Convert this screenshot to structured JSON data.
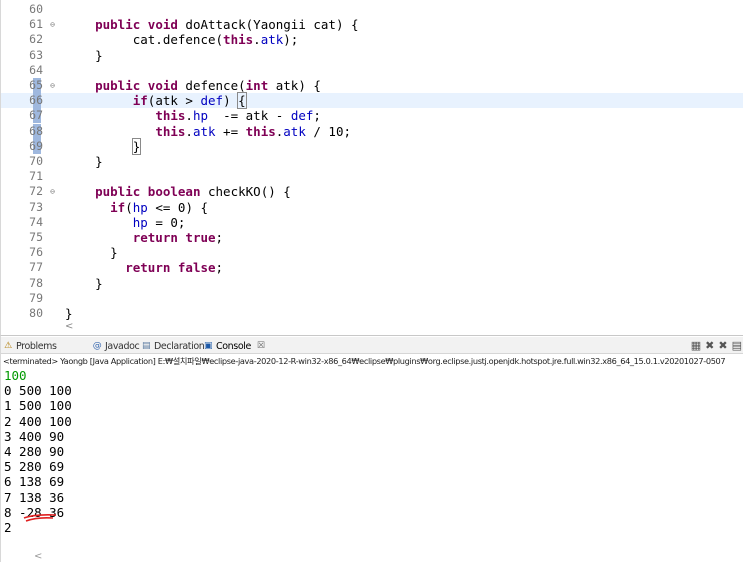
{
  "editor": {
    "lines": [
      {
        "num": "60",
        "fold": "",
        "segs": []
      },
      {
        "num": "61",
        "fold": "⊖",
        "segs": [
          [
            "",
            "    "
          ],
          [
            "kw",
            "public"
          ],
          [
            "",
            " "
          ],
          [
            "kw",
            "void"
          ],
          [
            "",
            " doAttack(Yaongii cat) {"
          ]
        ]
      },
      {
        "num": "62",
        "fold": "",
        "segs": [
          [
            "",
            "         cat.defence("
          ],
          [
            "kw",
            "this"
          ],
          [
            "",
            "."
          ],
          [
            "fld",
            "atk"
          ],
          [
            "",
            ");"
          ]
        ]
      },
      {
        "num": "63",
        "fold": "",
        "segs": [
          [
            "",
            "    }"
          ]
        ]
      },
      {
        "num": "64",
        "fold": "",
        "segs": []
      },
      {
        "num": "65",
        "fold": "⊖",
        "segs": [
          [
            "",
            "    "
          ],
          [
            "kw",
            "public"
          ],
          [
            "",
            " "
          ],
          [
            "kw",
            "void"
          ],
          [
            "",
            " defence("
          ],
          [
            "kw",
            "int"
          ],
          [
            "",
            " atk) {"
          ]
        ]
      },
      {
        "num": "66",
        "fold": "",
        "segs": [
          [
            "",
            "         "
          ],
          [
            "kw",
            "if"
          ],
          [
            "",
            "(atk > "
          ],
          [
            "fld",
            "def"
          ],
          [
            "",
            ") {"
          ]
        ]
      },
      {
        "num": "67",
        "fold": "",
        "segs": [
          [
            "",
            "            "
          ],
          [
            "kw",
            "this"
          ],
          [
            "",
            "."
          ],
          [
            "fld",
            "hp"
          ],
          [
            "",
            "  -= atk - "
          ],
          [
            "fld",
            "def"
          ],
          [
            "",
            ";"
          ]
        ]
      },
      {
        "num": "68",
        "fold": "",
        "segs": [
          [
            "",
            "            "
          ],
          [
            "kw",
            "this"
          ],
          [
            "",
            "."
          ],
          [
            "fld",
            "atk"
          ],
          [
            "",
            " += "
          ],
          [
            "kw",
            "this"
          ],
          [
            "",
            "."
          ],
          [
            "fld",
            "atk"
          ],
          [
            "",
            " / 10;"
          ]
        ]
      },
      {
        "num": "69",
        "fold": "",
        "segs": [
          [
            "",
            "         }"
          ]
        ]
      },
      {
        "num": "70",
        "fold": "",
        "segs": [
          [
            "",
            "    }"
          ]
        ]
      },
      {
        "num": "71",
        "fold": "",
        "segs": []
      },
      {
        "num": "72",
        "fold": "⊖",
        "segs": [
          [
            "",
            "    "
          ],
          [
            "kw",
            "public"
          ],
          [
            "",
            " "
          ],
          [
            "kw",
            "boolean"
          ],
          [
            "",
            " checkKO() {"
          ]
        ]
      },
      {
        "num": "73",
        "fold": "",
        "segs": [
          [
            "",
            "      "
          ],
          [
            "kw",
            "if"
          ],
          [
            "",
            "("
          ],
          [
            "fld",
            "hp"
          ],
          [
            "",
            " <= 0) {"
          ]
        ]
      },
      {
        "num": "74",
        "fold": "",
        "segs": [
          [
            "",
            "         "
          ],
          [
            "fld",
            "hp"
          ],
          [
            "",
            " = 0;"
          ]
        ]
      },
      {
        "num": "75",
        "fold": "",
        "segs": [
          [
            "",
            "         "
          ],
          [
            "kw",
            "return"
          ],
          [
            "",
            " "
          ],
          [
            "kw",
            "true"
          ],
          [
            "",
            ";"
          ]
        ]
      },
      {
        "num": "76",
        "fold": "",
        "segs": [
          [
            "",
            "      }"
          ]
        ]
      },
      {
        "num": "77",
        "fold": "",
        "segs": [
          [
            "",
            "        "
          ],
          [
            "kw",
            "return"
          ],
          [
            "",
            " "
          ],
          [
            "kw",
            "false"
          ],
          [
            "",
            ";"
          ]
        ]
      },
      {
        "num": "78",
        "fold": "",
        "segs": [
          [
            "",
            "    }"
          ]
        ]
      },
      {
        "num": "79",
        "fold": "",
        "segs": []
      },
      {
        "num": "80",
        "fold": "",
        "segs": [
          [
            "",
            "}"
          ]
        ]
      }
    ],
    "current_line": "66",
    "highlight_bar_lines": [
      "65",
      "66",
      "67",
      "68",
      "69"
    ]
  },
  "console": {
    "tabs": [
      {
        "label": "Problems",
        "icon": "problems-icon",
        "glyph": "⚠"
      },
      {
        "label": "Javadoc",
        "icon": "javadoc-icon",
        "glyph": "@"
      },
      {
        "label": "Declaration",
        "icon": "declaration-icon",
        "glyph": "▤"
      },
      {
        "label": "Console",
        "icon": "console-icon",
        "glyph": "▣",
        "close": "☒"
      }
    ],
    "toolbar_icons": [
      {
        "name": "clear-console-icon",
        "glyph": "▦"
      },
      {
        "name": "remove-launch-icon",
        "glyph": "✖"
      },
      {
        "name": "remove-all-icon",
        "glyph": "✖"
      },
      {
        "name": "scroll-lock-icon",
        "glyph": "▤"
      }
    ],
    "terminated_text": "<terminated> Yaongb [Java Application] E:₩설치파일₩eclipse-java-2020-12-R-win32-x86_64₩eclipse₩plugins₩org.eclipse.justj.openjdk.hotspot.jre.full.win32.x86_64_15.0.1.v20201027-0507",
    "input_line": "100",
    "output_lines": [
      "0 500 100",
      "1 500 100",
      "2 400 100",
      "3 400 90",
      "4 280 90",
      "5 280 69",
      "6 138 69",
      "7 138 36",
      "8 -28 36",
      "2"
    ],
    "scroll_arrow": "<"
  },
  "colors": {
    "keyword": "#7f0055",
    "field": "#0000c0",
    "input_text": "#009900",
    "current_line_bg": "#e8f2fe",
    "annotation_red": "#e02020"
  }
}
